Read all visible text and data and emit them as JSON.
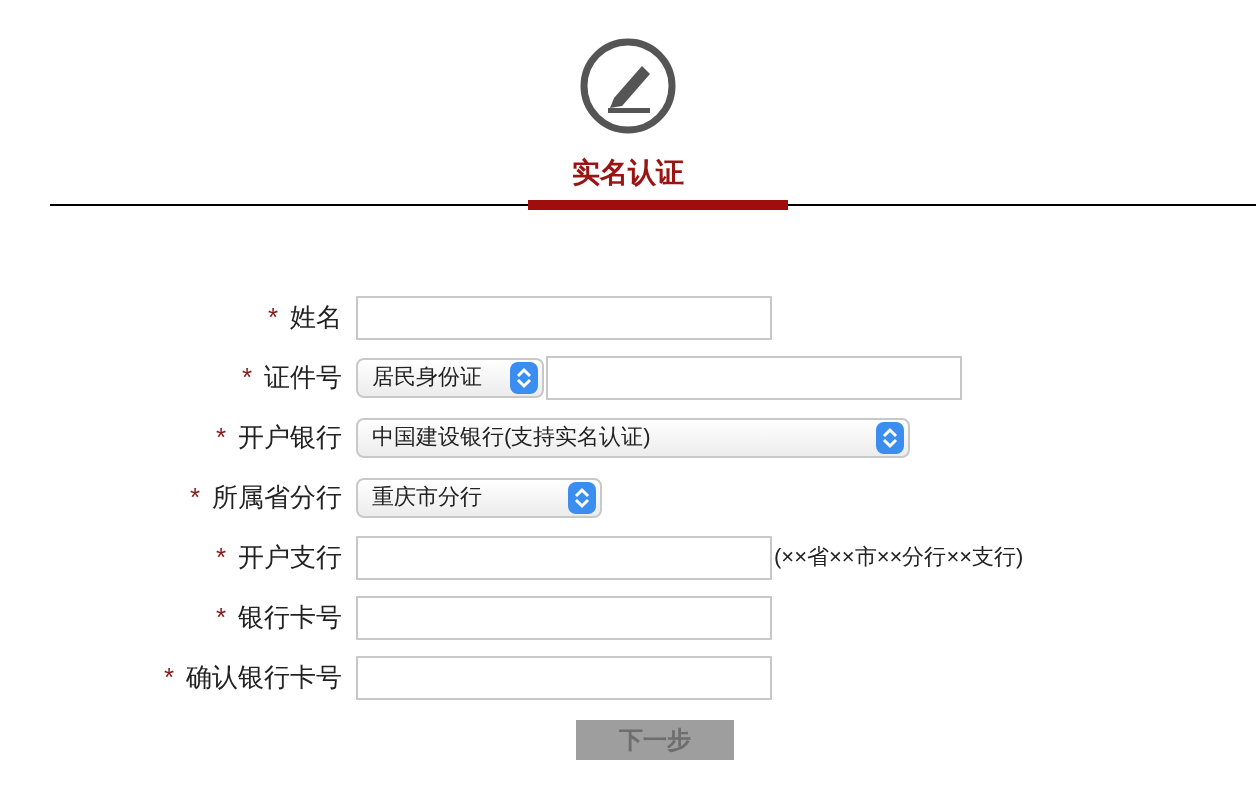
{
  "header": {
    "title": "实名认证"
  },
  "fields": [
    {
      "kind": "text",
      "mark": "*",
      "label": "姓名"
    },
    {
      "kind": "select_text",
      "mark": "*",
      "label": "证件号",
      "value": "居民身份证"
    },
    {
      "kind": "wide_select",
      "mark": "*",
      "label": "开户银行",
      "value": "中国建设银行(支持实名认证)"
    },
    {
      "kind": "short_select",
      "mark": "*",
      "label": "所属省分行",
      "value": "重庆市分行"
    },
    {
      "kind": "text",
      "mark": "*",
      "label": "开户支行",
      "hint": "(××省××市××分行××支行)"
    },
    {
      "kind": "text",
      "mark": "*",
      "label": "银行卡号"
    },
    {
      "kind": "text",
      "mark": "*",
      "label": "确认银行卡号"
    }
  ],
  "next_button": {
    "label": "下一步",
    "disabled": true
  }
}
